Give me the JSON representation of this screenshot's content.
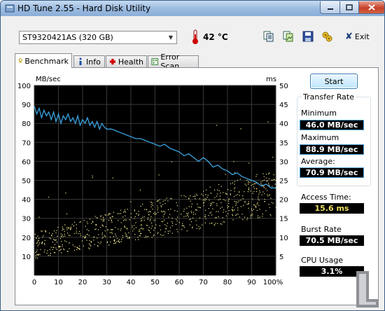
{
  "window": {
    "title": "HD Tune 2.55 - Hard Disk Utility"
  },
  "toolbar": {
    "drive": "ST9320421AS (320 GB)",
    "temperature": "42 °C",
    "exit_label": "Exit",
    "icons": [
      "copy-text-icon",
      "copy-image-icon",
      "save-icon",
      "options-icon"
    ]
  },
  "tabs": [
    {
      "label": "Benchmark",
      "icon": "benchmark-icon",
      "active": true
    },
    {
      "label": "Info",
      "icon": "info-icon"
    },
    {
      "label": "Health",
      "icon": "health-icon"
    },
    {
      "label": "Error Scan",
      "icon": "error-scan-icon"
    }
  ],
  "side": {
    "start_label": "Start",
    "transfer_rate_title": "Transfer Rate",
    "minimum_label": "Minimum",
    "minimum_value": "46.0 MB/sec",
    "maximum_label": "Maximum",
    "maximum_value": "88.9 MB/sec",
    "average_label": "Average:",
    "average_value": "70.9 MB/sec",
    "access_time_label": "Access Time:",
    "access_time_value": "15.6 ms",
    "burst_rate_label": "Burst Rate",
    "burst_rate_value": "70.5 MB/sec",
    "cpu_usage_label": "CPU Usage",
    "cpu_usage_value": "3.1%"
  },
  "colors": {
    "transfer_line": "#3aa3e0",
    "access_points": "#f0e68c",
    "background": "#000000",
    "grid": "#3a3a3a"
  },
  "chart_data": {
    "type": "line",
    "left_axis_label": "MB/sec",
    "right_axis_label": "ms",
    "left_ticks": [
      "100",
      "90",
      "80",
      "70",
      "60",
      "50",
      "40",
      "30",
      "20",
      "10"
    ],
    "right_ticks": [
      "50",
      "45",
      "40",
      "35",
      "30",
      "25",
      "20",
      "15",
      "10",
      "5"
    ],
    "x_ticks": [
      "0",
      "10",
      "20",
      "30",
      "40",
      "50",
      "60",
      "70",
      "80",
      "90",
      "100%"
    ],
    "ylim_left": [
      0,
      100
    ],
    "ylim_right": [
      0,
      50
    ],
    "xlim": [
      0,
      100
    ],
    "transfer_series": {
      "x": [
        0,
        1,
        2,
        3,
        4,
        5,
        6,
        7,
        8,
        9,
        10,
        11,
        12,
        13,
        14,
        15,
        16,
        17,
        18,
        19,
        20,
        21,
        22,
        23,
        24,
        25,
        26,
        27,
        28,
        29,
        30,
        32,
        34,
        36,
        38,
        40,
        42,
        44,
        46,
        48,
        50,
        52,
        54,
        56,
        58,
        60,
        62,
        64,
        66,
        68,
        70,
        72,
        74,
        76,
        78,
        80,
        82,
        84,
        86,
        88,
        90,
        92,
        94,
        96,
        98,
        100
      ],
      "y": [
        89,
        85,
        88,
        83,
        87,
        84,
        86,
        82,
        86,
        81,
        85,
        80,
        84,
        82,
        85,
        81,
        83,
        80,
        84,
        79,
        82,
        80,
        83,
        79,
        81,
        78,
        81,
        77,
        80,
        78,
        77,
        77,
        76,
        75,
        74,
        73,
        72,
        72,
        71,
        70,
        69,
        68,
        69,
        67,
        66,
        65,
        63,
        64,
        62,
        60,
        62,
        60,
        57,
        58,
        56,
        55,
        53,
        54,
        52,
        51,
        50,
        49,
        47,
        48,
        46,
        46
      ]
    },
    "access_time_points": "scatter of ~800 points rising from ~5-12 ms at 0% to ~18-28 ms at 100%"
  }
}
